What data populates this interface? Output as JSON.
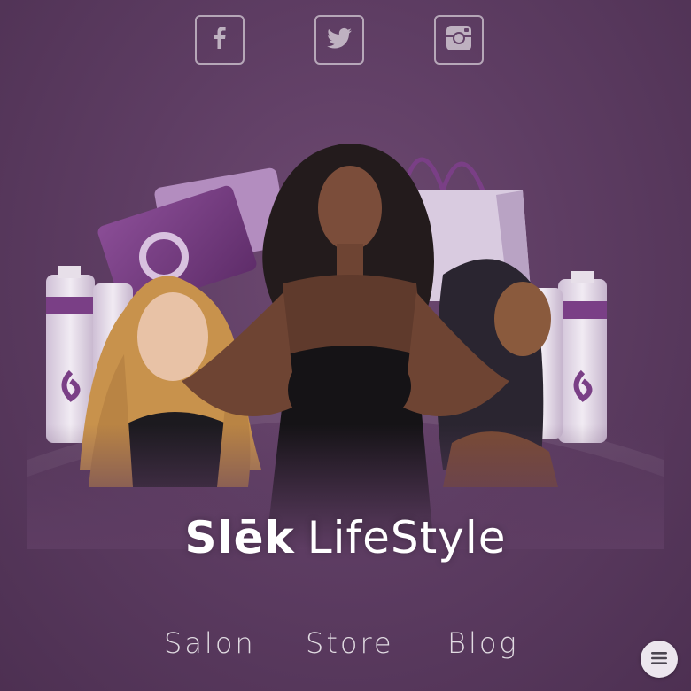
{
  "social": {
    "icons": [
      "facebook-icon",
      "twitter-icon",
      "instagram-icon"
    ]
  },
  "brand": {
    "part1": "Slēk",
    "part2": "LifeStyle"
  },
  "nav": {
    "items": [
      "Salon",
      "Store",
      "Blog"
    ]
  },
  "menu": {
    "icon": "hamburger-menu-icon"
  },
  "colors": {
    "background": "#5e3d63",
    "accent": "#7a3f86",
    "text": "#ffffff"
  }
}
